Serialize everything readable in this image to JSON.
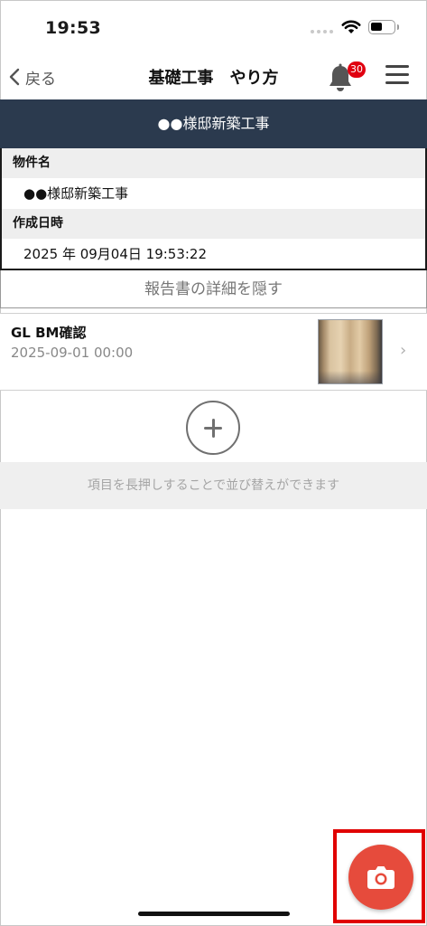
{
  "status_bar": {
    "time": "19:53"
  },
  "nav": {
    "back_label": "戻る",
    "title": "基礎工事　やり方",
    "notification_count": "30"
  },
  "project_header": {
    "title": "●●様邸新築工事"
  },
  "details": {
    "property_label": "物件名",
    "property_value": "●●様邸新築工事",
    "created_label": "作成日時",
    "created_value": "2025 年 09月04日 19:53:22"
  },
  "toggle_details_label": "報告書の詳細を隠す",
  "reports": [
    {
      "title": "GL BM確認",
      "date": "2025-09-01 00:00",
      "thumbnail_icon": "wood-wall-photo"
    }
  ],
  "hint_text": "項目を長押しすることで並び替えができます",
  "colors": {
    "header_bg": "#2b3a4e",
    "fab": "#e64b3c",
    "badge": "#e00010",
    "highlight": "#e00000"
  },
  "icons": {
    "back": "chevron-left-icon",
    "bell": "bell-icon",
    "menu": "hamburger-menu-icon",
    "add": "plus-circle-icon",
    "camera": "camera-icon",
    "row": "chevron-right-icon"
  }
}
